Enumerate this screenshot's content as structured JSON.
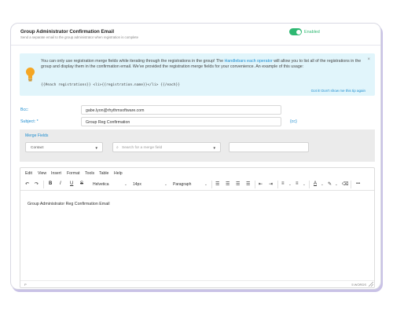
{
  "header": {
    "title": "Group Administrator Confirmation Email",
    "subtitle": "Send a separate email to the group administrator when registration is complete",
    "toggle": {
      "label": "Enabled",
      "on": true,
      "color": "#2eb872"
    }
  },
  "tip": {
    "text_before": "You can only use registration merge fields while iterating through the registrations in the group! The ",
    "link": "Handlebars each operator",
    "text_after": " will allow you to list all of the registrations in the group and display them in the confirmation email. We've provided the registration merge fields for your convenience. An example of this usage:",
    "code": "{{#each registrations}} <li>{{registration.name}}</li> {{/each}}",
    "close": "×",
    "dismiss": "Got it! Don't show me this tip again",
    "icon": "lightbulb-icon",
    "background": "#e1f5fb"
  },
  "fields": {
    "bcc_label": "Bcc:",
    "bcc_value": "gabe.lyon@rhythmsoftware.com",
    "subject_label": "Subject: *",
    "subject_value": "Group Reg Confirmation",
    "cc_link": "{cc}"
  },
  "merge": {
    "label": "Merge Fields",
    "category": "Contact",
    "search_placeholder": "Search for a merge field",
    "value": ""
  },
  "editor": {
    "menu": [
      "Edit",
      "View",
      "Insert",
      "Format",
      "Tools",
      "Table",
      "Help"
    ],
    "font": "Helvetica",
    "size": "14px",
    "block": "Paragraph",
    "bold": "B",
    "italic": "I",
    "underline": "U",
    "strike": "S",
    "more": "•••",
    "content": "Group Administrator Reg Confirmation Email",
    "status_path": "P",
    "word_count": "5 WORDS"
  },
  "colors": {
    "accent": "#1c8ccf",
    "success": "#2eb872"
  }
}
